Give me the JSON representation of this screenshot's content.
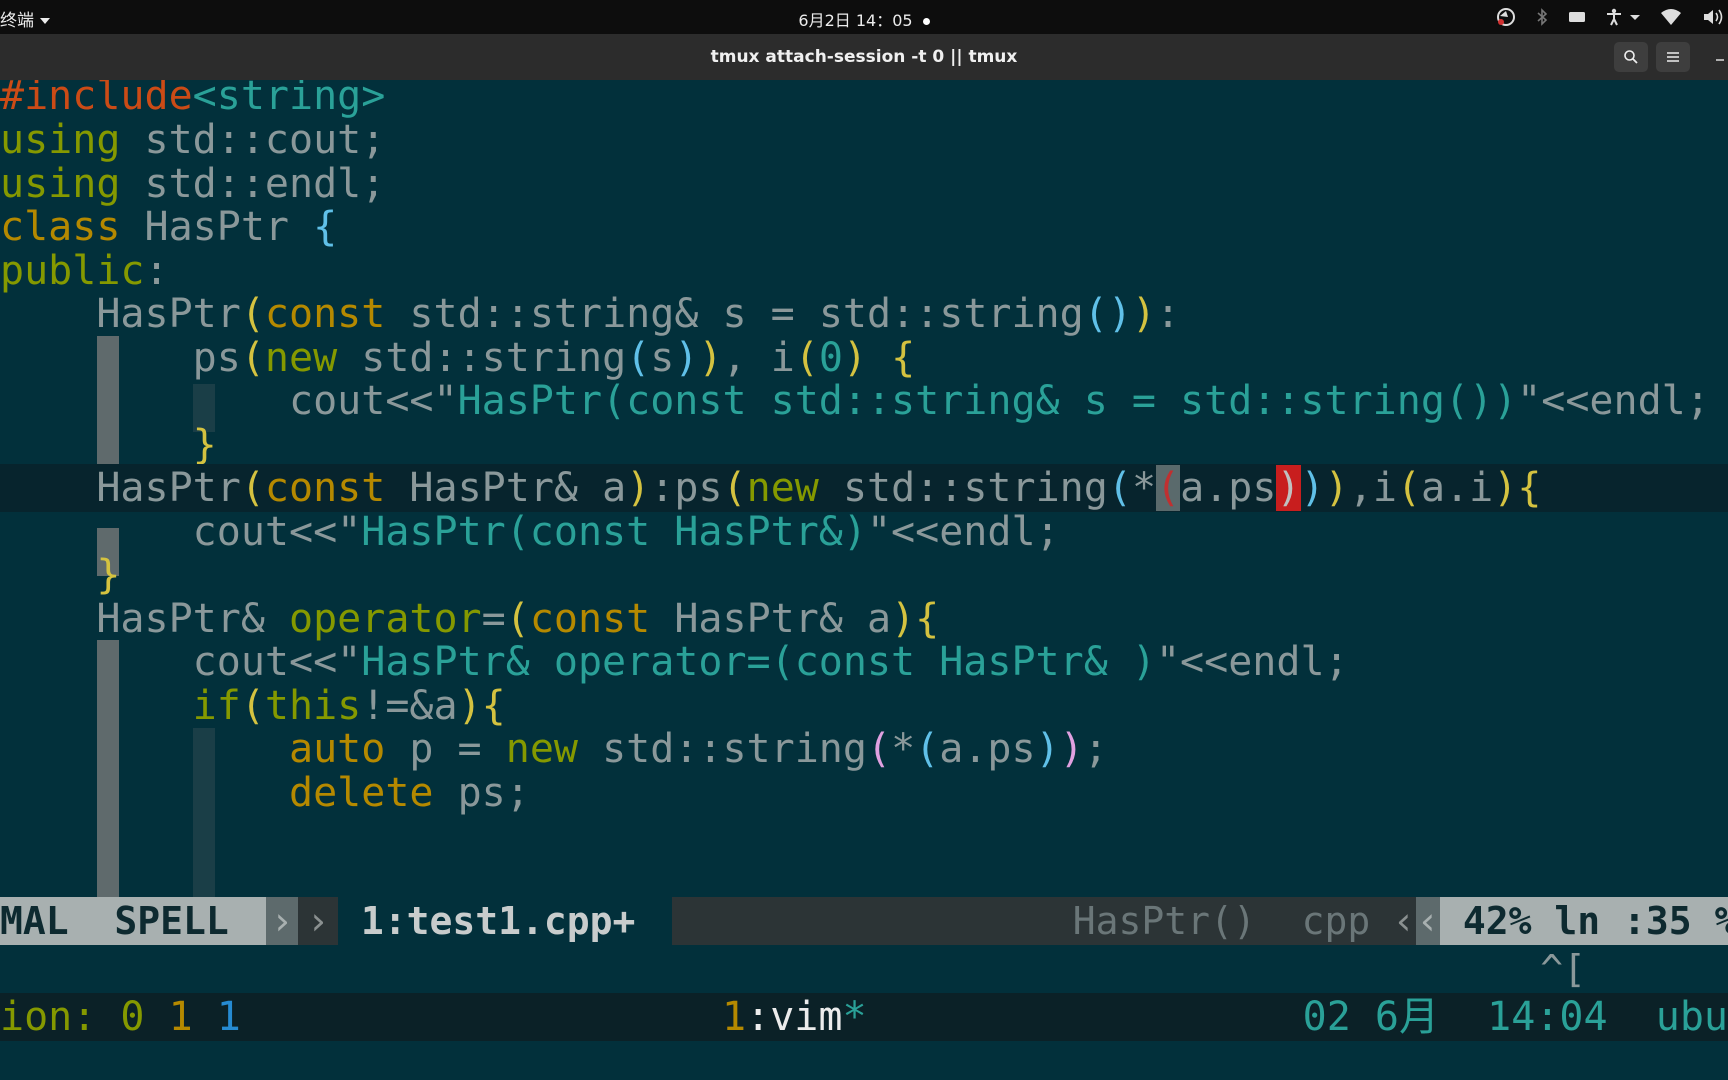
{
  "topbar": {
    "app_name": "终端",
    "clock": "6月2日  14：05",
    "tray_icons": [
      "screen-record-icon",
      "bluetooth-icon",
      "keyboard-icon",
      "accessibility-icon",
      "wifi-icon",
      "volume-icon"
    ]
  },
  "window": {
    "title": "tmux attach-session -t 0 || tmux",
    "buttons": [
      "search-icon",
      "hamburger-menu-icon",
      "minimize-icon"
    ]
  },
  "editor": {
    "lines": [
      "#include<string>",
      "using std::cout;",
      "using std::endl;",
      "class HasPtr {",
      "public:",
      "    HasPtr(const std::string& s = std::string()):",
      "        ps(new std::string(s)), i(0) {",
      "            cout<<\"HasPtr(const std::string& s = std::string())\"<<endl;",
      "        }",
      "    HasPtr(const HasPtr& a):ps(new std::string(*(a.ps))),i(a.i){",
      "        cout<<\"HasPtr(const HasPtr&)\"<<endl;",
      "    }",
      "    HasPtr& operator=(const HasPtr& a){",
      "        cout<<\"HasPtr& operator=(const HasPtr& )\"<<endl;",
      "        if(this!=&a){",
      "            auto p = new std::string(*(a.ps));",
      "            delete ps;"
    ],
    "cursor_line_index": 9
  },
  "airline": {
    "mode": "MAL",
    "spell": "SPELL",
    "file": "1:test1.cpp+",
    "function": "HasPtr()",
    "filetype": "cpp",
    "percent": "42%",
    "line": "ln :35",
    "col": "%:"
  },
  "cmdline": {
    "keys": "^["
  },
  "tmux": {
    "session_label": "ion:",
    "session_nums": [
      "0",
      "1",
      "1"
    ],
    "window_index": "1",
    "window_name": "vim",
    "window_flag": "*",
    "date": "02 6月",
    "time": "14:04",
    "host": "ubu"
  },
  "colors": {
    "background": "#02303b",
    "keyword_green": "#859900",
    "keyword_yellow": "#b58900",
    "preprocessor": "#cb4b16",
    "string": "#2aa198",
    "bracket_error": "#c81e1e"
  }
}
